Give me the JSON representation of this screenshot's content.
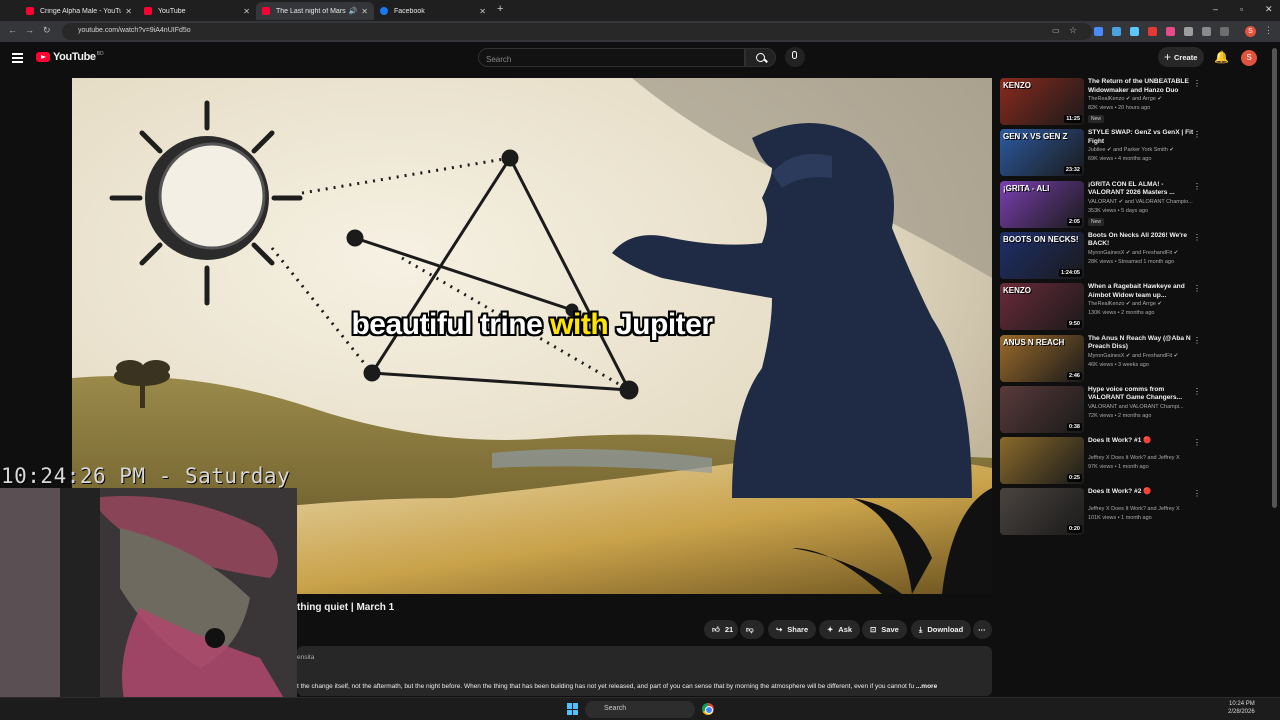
{
  "browser": {
    "tabs": [
      {
        "title": "Cringe Alpha Male - YouTube",
        "favicon": "youtube-icon",
        "active": false
      },
      {
        "title": "YouTube",
        "favicon": "youtube-icon",
        "active": false
      },
      {
        "title": "The Last night of Mars in A",
        "favicon": "youtube-icon",
        "active": true,
        "audio": true
      },
      {
        "title": "Facebook",
        "favicon": "facebook-icon",
        "active": false
      }
    ],
    "url": "youtube.com/watch?v=9iA4nUIFd5o",
    "profile_initial": "S"
  },
  "header": {
    "logo_text": "YouTube",
    "country_code": "BD",
    "search_placeholder": "Search",
    "create_label": "Create",
    "avatar_initial": "S"
  },
  "player": {
    "caption_before": "beautiful trine ",
    "caption_highlight": "with",
    "caption_after": " Jupiter"
  },
  "webcam": {
    "clock": "10:24:26 PM - Saturday"
  },
  "video": {
    "title_fragment": "thing quiet | March 1",
    "likes": "21",
    "share_label": "Share",
    "ask_label": "Ask",
    "save_label": "Save",
    "download_label": "Download",
    "channel_fragment": "ensita",
    "description": "t the change itself, not the aftermath, but the night before. When the thing that has been building has not yet released, and part of you can sense that by morning the atmosphere will be different, even if you cannot fu",
    "more_label": " ...more"
  },
  "recommendations": [
    {
      "title": "The Return of the UNBEATABLE Widowmaker and Hanzo Duo",
      "channel": "TheRealKenzo ✔ and Arrge ✔",
      "meta": "82K views • 20 hours ago",
      "badge": "New",
      "duration": "11:25",
      "thumb_text": "KENZO",
      "thumb_color": "#8a2a1e"
    },
    {
      "title": "STYLE SWAP: GenZ vs GenX | Fit Fight",
      "channel": "Jubilee ✔ and Parker York Smith ✔",
      "meta": "69K views • 4 months ago",
      "badge": "",
      "duration": "23:32",
      "thumb_text": "GEN X VS GEN Z",
      "thumb_color": "#2c5aa0"
    },
    {
      "title": "¡GRITA CON EL ALMA! - VALORANT 2026 Masters ...",
      "channel": "VALORANT ✔ and VALORANT Champio...",
      "meta": "353K views • 5 days ago",
      "badge": "New",
      "duration": "2:05",
      "thumb_text": "¡GRITA - ALI",
      "thumb_color": "#7a3fb0"
    },
    {
      "title": "Boots On Necks All 2026! We're BACK!",
      "channel": "MyronGainesX ✔ and FreshandFit ✔",
      "meta": "28K views • Streamed 1 month ago",
      "badge": "",
      "duration": "1:24:05",
      "thumb_text": "BOOTS ON NECKS!",
      "thumb_color": "#1e2f6b"
    },
    {
      "title": "When a Ragebait Hawkeye and Aimbot Widow team up...",
      "channel": "TheRealKenzo ✔ and Arrge ✔",
      "meta": "130K views • 2 months ago",
      "badge": "",
      "duration": "9:50",
      "thumb_text": "KENZO",
      "thumb_color": "#6b2a3a"
    },
    {
      "title": "The Anus N Reach Way (@Aba N Preach Diss)",
      "channel": "MyronGainesX ✔ and FreshandFit ✔",
      "meta": "46K views • 3 weeks ago",
      "badge": "",
      "duration": "2:46",
      "thumb_text": "ANUS N REACH",
      "thumb_color": "#9a6a2a"
    },
    {
      "title": "Hype voice comms from VALORANT Game Changers...",
      "channel": "VALORANT and VALORANT Champi...",
      "meta": "72K views • 2 months ago",
      "badge": "",
      "duration": "0:38",
      "thumb_text": "",
      "thumb_color": "#5a3a3a"
    },
    {
      "title": "Does It Work? #1 🔴",
      "channel": "Jeffrey X Does It Work? and Jeffrey X",
      "meta": "97K views • 1 month ago",
      "badge": "",
      "duration": "0:25",
      "thumb_text": "",
      "thumb_color": "#8a6a2a"
    },
    {
      "title": "Does It Work? #2 🔴",
      "channel": "Jeffrey X Does It Work? and Jeffrey X",
      "meta": "101K views • 1 month ago",
      "badge": "",
      "duration": "0:20",
      "thumb_text": "",
      "thumb_color": "#4a4440"
    }
  ],
  "taskbar": {
    "search_placeholder": "Search",
    "time": "10:24 PM",
    "date": "2/28/2026"
  }
}
